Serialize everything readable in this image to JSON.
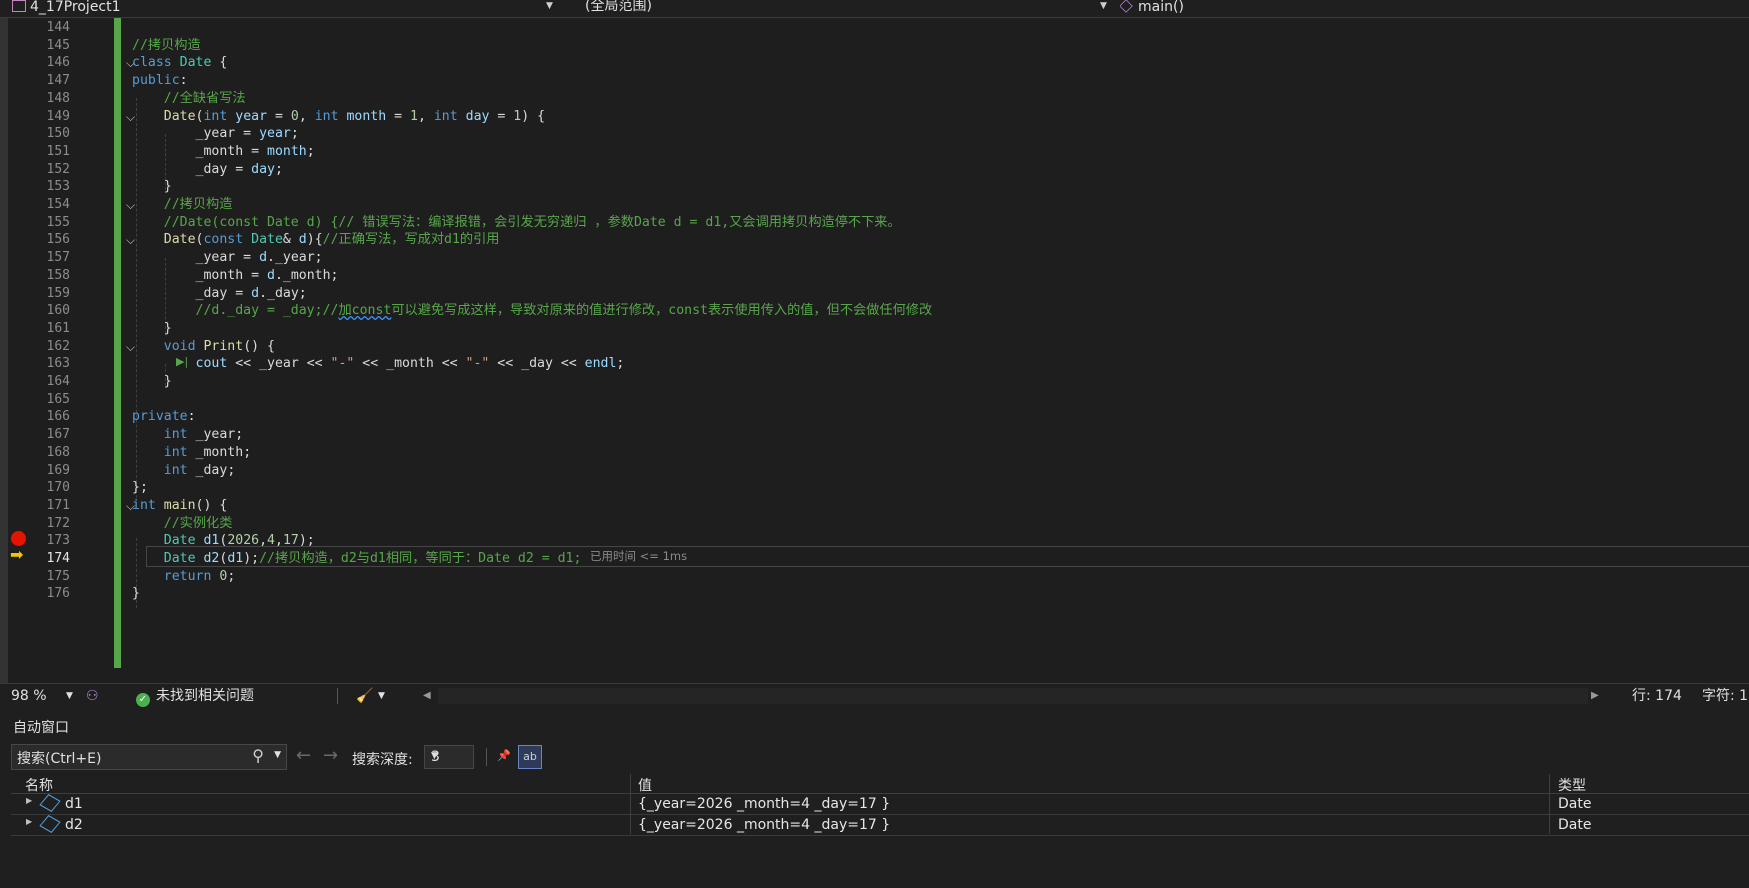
{
  "toolbar": {
    "project": "4_17Project1",
    "scope": "(全局范围)",
    "function": "main()"
  },
  "code_lines": [
    {
      "n": "144",
      "html": ""
    },
    {
      "n": "145",
      "html": "<span class=\"cm\">//拷贝构造</span>"
    },
    {
      "n": "146",
      "html": "<span class=\"kw\">class</span> <span class=\"ty\">Date</span> {"
    },
    {
      "n": "147",
      "html": "<span class=\"kw\">public</span>:"
    },
    {
      "n": "148",
      "html": "    <span class=\"cm\">//全缺省写法</span>"
    },
    {
      "n": "149",
      "html": "    <span class=\"fn\">Date</span>(<span class=\"kw\">int</span> <span class=\"pr\">year</span> = <span class=\"num\">0</span>, <span class=\"kw\">int</span> <span class=\"pr\">month</span> = <span class=\"num\">1</span>, <span class=\"kw\">int</span> <span class=\"pr\">day</span> = <span class=\"num\">1</span>) {"
    },
    {
      "n": "150",
      "html": "        <span class=\"mem\">_year</span> = <span class=\"pr\">year</span>;"
    },
    {
      "n": "151",
      "html": "        <span class=\"mem\">_month</span> = <span class=\"pr\">month</span>;"
    },
    {
      "n": "152",
      "html": "        <span class=\"mem\">_day</span> = <span class=\"pr\">day</span>;"
    },
    {
      "n": "153",
      "html": "    }"
    },
    {
      "n": "154",
      "html": "    <span class=\"cm\">//拷贝构造</span>"
    },
    {
      "n": "155",
      "html": "    <span class=\"cm\">//Date(const Date d) {// 错误写法：编译报错，会引发无穷递归 ，参数Date d = d1,又会调用拷贝构造停不下来。</span>"
    },
    {
      "n": "156",
      "html": "    <span class=\"fn\">Date</span>(<span class=\"kw\">const</span> <span class=\"ty\">Date</span>&amp; <span class=\"pr\">d</span>){<span class=\"cm\">//正确写法，写成对d1的引用</span>"
    },
    {
      "n": "157",
      "html": "        <span class=\"mem\">_year</span> = <span class=\"pr\">d</span>.<span class=\"mem\">_year</span>;"
    },
    {
      "n": "158",
      "html": "        <span class=\"mem\">_month</span> = <span class=\"pr\">d</span>.<span class=\"mem\">_month</span>;"
    },
    {
      "n": "159",
      "html": "        <span class=\"mem\">_day</span> = <span class=\"pr\">d</span>.<span class=\"mem\">_day</span>;"
    },
    {
      "n": "160",
      "html": "        <span class=\"cm\">//d._day = _day;//<span class=\"squig\">加const</span>可以避免写成这样，导致对原来的值进行修改，const表示使用传入的值，但不会做任何修改</span>"
    },
    {
      "n": "161",
      "html": "    }"
    },
    {
      "n": "162",
      "html": "    <span class=\"kw\">void</span> <span class=\"fn\">Print</span>() {"
    },
    {
      "n": "163",
      "html": "        <span class=\"pr\">cout</span> &lt;&lt; <span class=\"mem\">_year</span> &lt;&lt; <span class=\"str\">\"-\"</span> &lt;&lt; <span class=\"mem\">_month</span> &lt;&lt; <span class=\"str\">\"-\"</span> &lt;&lt; <span class=\"mem\">_day</span> &lt;&lt; <span class=\"pr\">endl</span>;"
    },
    {
      "n": "164",
      "html": "    }"
    },
    {
      "n": "165",
      "html": ""
    },
    {
      "n": "166",
      "html": "<span class=\"kw\">private</span>:"
    },
    {
      "n": "167",
      "html": "    <span class=\"kw\">int</span> <span class=\"mem\">_year</span>;"
    },
    {
      "n": "168",
      "html": "    <span class=\"kw\">int</span> <span class=\"mem\">_month</span>;"
    },
    {
      "n": "169",
      "html": "    <span class=\"kw\">int</span> <span class=\"mem\">_day</span>;"
    },
    {
      "n": "170",
      "html": "};"
    },
    {
      "n": "171",
      "html": "<span class=\"kw\">int</span> <span class=\"fn\">main</span>() {"
    },
    {
      "n": "172",
      "html": "    <span class=\"cm\">//实例化类</span>"
    },
    {
      "n": "173",
      "html": "    <span class=\"ty\">Date</span> <span class=\"pr\">d1</span>(<span class=\"num\">2026</span>,<span class=\"num\">4</span>,<span class=\"num\">17</span>);"
    },
    {
      "n": "174",
      "html": "    <span class=\"ty\">Date</span> <span class=\"pr\">d2</span>(<span class=\"pr\">d1</span>);<span class=\"cm\">//拷贝构造，d2与d1相同，等同于：Date d2 = d1;</span>"
    },
    {
      "n": "175",
      "html": "    <span class=\"kw\">return</span> <span class=\"num\">0</span>;"
    },
    {
      "n": "176",
      "html": "}"
    }
  ],
  "editor": {
    "elapsed": "已用时间 <= 1ms",
    "current_line": "174",
    "breakpoint_line": "173"
  },
  "status": {
    "zoom": "98 %",
    "issues": "未找到相关问题",
    "line_pos": "行: 174",
    "char_pos": "字符: 1"
  },
  "autos": {
    "title": "自动窗口",
    "search_placeholder": "搜索(Ctrl+E)",
    "depth_label": "搜索深度:",
    "depth_value": "3",
    "columns": {
      "name": "名称",
      "value": "值",
      "type": "类型"
    },
    "rows": [
      {
        "name": "d1",
        "value": "{_year=2026 _month=4 _day=17 }",
        "type": "Date"
      },
      {
        "name": "d2",
        "value": "{_year=2026 _month=4 _day=17 }",
        "type": "Date"
      }
    ]
  },
  "colors": {
    "keyword": "#569cd6",
    "comment": "#57a64a",
    "type": "#4ec9b0",
    "function": "#dcdcaa",
    "breakpoint": "#e51400",
    "change_bar": "#57a64a"
  }
}
